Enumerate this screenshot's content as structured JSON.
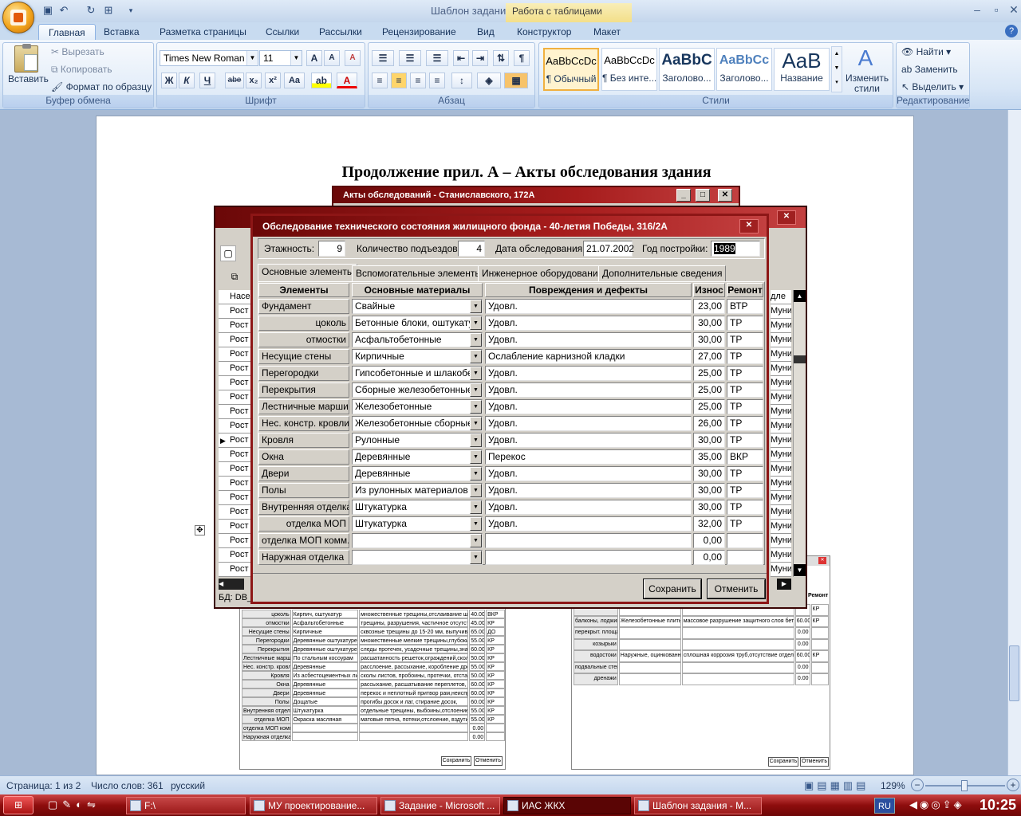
{
  "window": {
    "title": "Шаблон задания - Microsoft Word",
    "context_tab": "Работа с таблицами"
  },
  "tabs": [
    "Главная",
    "Вставка",
    "Разметка страницы",
    "Ссылки",
    "Рассылки",
    "Рецензирование",
    "Вид",
    "Конструктор",
    "Макет"
  ],
  "ribbon": {
    "clipboard": {
      "paste": "Вставить",
      "cut": "Вырезать",
      "copy": "Копировать",
      "format_painter": "Формат по образцу",
      "label": "Буфер обмена"
    },
    "font": {
      "name": "Times New Roman",
      "size": "11",
      "label": "Шрифт",
      "bold": "Ж",
      "italic": "К",
      "underline": "Ч",
      "strike": "abe",
      "sub": "x₂",
      "sup": "x²",
      "case": "Aa"
    },
    "paragraph": {
      "label": "Абзац"
    },
    "styles": {
      "label": "Стили",
      "items": [
        {
          "sample": "AaBbCcDc",
          "name": "¶ Обычный"
        },
        {
          "sample": "AaBbCcDc",
          "name": "¶ Без инте..."
        },
        {
          "sample": "AaBbC",
          "name": "Заголово..."
        },
        {
          "sample": "AaBbCc",
          "name": "Заголово..."
        },
        {
          "sample": "AaB",
          "name": "Название"
        }
      ],
      "change": "Изменить стили"
    },
    "editing": {
      "label": "Редактирование",
      "find": "Найти",
      "replace": "Заменить",
      "select": "Выделить"
    }
  },
  "document": {
    "heading": "Продолжение прил. А – Акты обследования здания"
  },
  "back_window": {
    "title": "Акты обследований - Станиславского, 172А",
    "status": "БД: DB_",
    "col_label": "Рост",
    "col_right": "Муни",
    "col_head_left": "Насе",
    "col_head_right": "дле"
  },
  "dialog": {
    "title": "Обследование технического состояния жилищного фонда - 40-летия Победы, 316/2А",
    "floors_label": "Этажность:",
    "floors": "9",
    "entrances_label": "Количество подъездов:",
    "entrances": "4",
    "date_label": "Дата обследования:",
    "date": "21.07.2002",
    "year_label": "Год постройки:",
    "year": "1989",
    "tabs": [
      "Основные элементы",
      "Вспомогательные элементы",
      "Инженерное оборудование",
      "Дополнительные сведения"
    ],
    "columns": [
      "Элементы",
      "Основные материалы",
      "Повреждения и дефекты",
      "Износ",
      "Ремонт"
    ],
    "rows": [
      {
        "el": "Фундамент",
        "mat": "Свайные",
        "def": "Удовл.",
        "wear": "23,00",
        "rep": "ВТР",
        "indent": false
      },
      {
        "el": "цоколь",
        "mat": "Бетонные блоки, оштукатур",
        "def": "Удовл.",
        "wear": "30,00",
        "rep": "ТР",
        "indent": true
      },
      {
        "el": "отмостки",
        "mat": "Асфальтобетонные",
        "def": "Удовл.",
        "wear": "30,00",
        "rep": "ТР",
        "indent": true
      },
      {
        "el": "Несущие стены",
        "mat": "Кирпичные",
        "def": "Ослабление карнизной кладки",
        "wear": "27,00",
        "rep": "ТР",
        "indent": false
      },
      {
        "el": "Перегородки",
        "mat": "Гипсобетонные и шлакобето",
        "def": "Удовл.",
        "wear": "25,00",
        "rep": "ТР",
        "indent": false
      },
      {
        "el": "Перекрытия",
        "mat": "Сборные железобетонные п",
        "def": "Удовл.",
        "wear": "25,00",
        "rep": "ТР",
        "indent": false
      },
      {
        "el": "Лестничные марши",
        "mat": "Железобетонные",
        "def": "Удовл.",
        "wear": "25,00",
        "rep": "ТР",
        "indent": false
      },
      {
        "el": "Нес. констр. кровли",
        "mat": "Железобетонные сборные",
        "def": "Удовл.",
        "wear": "26,00",
        "rep": "ТР",
        "indent": false
      },
      {
        "el": "Кровля",
        "mat": "Рулонные",
        "def": "Удовл.",
        "wear": "30,00",
        "rep": "ТР",
        "indent": false
      },
      {
        "el": "Окна",
        "mat": "Деревянные",
        "def": "Перекос",
        "wear": "35,00",
        "rep": "ВКР",
        "indent": false
      },
      {
        "el": "Двери",
        "mat": "Деревянные",
        "def": "Удовл.",
        "wear": "30,00",
        "rep": "ТР",
        "indent": false
      },
      {
        "el": "Полы",
        "mat": "Из рулонных материалов",
        "def": "Удовл.",
        "wear": "30,00",
        "rep": "ТР",
        "indent": false
      },
      {
        "el": "Внутренняя отделка",
        "mat": "Штукатурка",
        "def": "Удовл.",
        "wear": "30,00",
        "rep": "ТР",
        "indent": false
      },
      {
        "el": "отделка МОП",
        "mat": "Штукатурка",
        "def": "Удовл.",
        "wear": "32,00",
        "rep": "ТР",
        "indent": true
      },
      {
        "el": "отделка МОП комм.",
        "mat": "",
        "def": "",
        "wear": "0,00",
        "rep": "",
        "indent": true
      },
      {
        "el": "Наружная отделка",
        "mat": "",
        "def": "",
        "wear": "0,00",
        "rep": "",
        "indent": false
      }
    ],
    "save": "Сохранить",
    "cancel": "Отменить"
  },
  "mini_left": {
    "rows": [
      {
        "el": "цоколь",
        "mat": "Кирпич, оштукатур",
        "def": "множественные трещины,отслаивание штукатур",
        "wear": "40.00",
        "rep": "ВКР"
      },
      {
        "el": "отмостки",
        "mat": "Асфальтобетонные",
        "def": "трещины, разрушения, частичное отсутствие,",
        "wear": "45.00",
        "rep": "КР"
      },
      {
        "el": "Несущие стены",
        "mat": "Кирпичные",
        "def": "сквозные трещины до 15-20 мм, выпучивание",
        "wear": "65.00",
        "rep": "ДО"
      },
      {
        "el": "Перегородки",
        "mat": "Деревянные оштукатурен",
        "def": "множественные мелкие трещины,глубокие трещ",
        "wear": "55.00",
        "rep": "КР"
      },
      {
        "el": "Перекрытия",
        "mat": "Деревянные оштукатуре",
        "def": "следы протечек, усадочные трещины,значитель",
        "wear": "60.00",
        "rep": "КР"
      },
      {
        "el": "Лестничные марши",
        "mat": "По стальным косоурам",
        "def": "расшатанность решеток,ограждений,сколы, выбо",
        "wear": "50.00",
        "rep": "КР"
      },
      {
        "el": "Нес. констр. кровли",
        "mat": "Деревянные",
        "def": "расслоение, рассыхание, коробление древесины",
        "wear": "55.00",
        "rep": "КР"
      },
      {
        "el": "Кровля",
        "mat": "Из асбестоцементных лист",
        "def": "сколы листов, пробоины, протечки, отставания и",
        "wear": "50.00",
        "rep": "КР"
      },
      {
        "el": "Окна",
        "mat": "Деревянные",
        "def": "рассыхание, расшатывание переплетов, расслое",
        "wear": "60.00",
        "rep": "КР"
      },
      {
        "el": "Двери",
        "mat": "Деревянные",
        "def": "перекос и неплотный притвор рам,неисправност",
        "wear": "60.00",
        "rep": "КР"
      },
      {
        "el": "Полы",
        "mat": "Дощатые",
        "def": "прогибы досок и лаг, стирание досок,",
        "wear": "60.00",
        "rep": "КР"
      },
      {
        "el": "Внутренняя отделка",
        "mat": "Штукатурка",
        "def": "отдельные трещины, выбоины,отслоение и обру",
        "wear": "55.00",
        "rep": "КР"
      },
      {
        "el": "отделка МОП",
        "mat": "Окраска масляная",
        "def": "матовые пятна, потеки,отслоение, вздутие и нес",
        "wear": "55.00",
        "rep": "КР"
      },
      {
        "el": "отделка МОП комм.",
        "mat": "",
        "def": "",
        "wear": "0.00",
        "rep": ""
      },
      {
        "el": "Наружная отделка",
        "mat": "",
        "def": "",
        "wear": "0.00",
        "rep": ""
      }
    ],
    "save": "Сохранить",
    "cancel": "Отменить"
  },
  "mini_right": {
    "header_rep": "Ремонт",
    "rows": [
      {
        "el": "",
        "mat": "",
        "def": "",
        "wear": "",
        "rep": "КР"
      },
      {
        "el": "балконы, лоджии",
        "mat": "Железобетонные плиты по",
        "def": "массовое разрушение защитного слоя бетона,оп",
        "wear": "60.00",
        "rep": "КР"
      },
      {
        "el": "перекрыт. площадки",
        "mat": "",
        "def": "",
        "wear": "0.00",
        "rep": ""
      },
      {
        "el": "козырьки",
        "mat": "",
        "def": "",
        "wear": "0.00",
        "rep": ""
      },
      {
        "el": "водостоки",
        "mat": "Наружные, оцинкованные т",
        "def": "сплошная коррозия труб,отсутствие отдельн труб",
        "wear": "60.00",
        "rep": "КР"
      },
      {
        "el": "подвальные стенки",
        "mat": "",
        "def": "",
        "wear": "0.00",
        "rep": ""
      },
      {
        "el": "дренажи",
        "mat": "",
        "def": "",
        "wear": "0.00",
        "rep": ""
      }
    ],
    "save": "Сохранить",
    "cancel": "Отменить"
  },
  "statusbar": {
    "page": "Страница: 1 из 2",
    "words": "Число слов: 361",
    "lang": "русский",
    "zoom": "129%"
  },
  "taskbar": {
    "items": [
      "F:\\",
      "МУ проектирование...",
      "Задание - Microsoft ...",
      "ИАС ЖКХ",
      "Шаблон задания - M..."
    ],
    "lang": "RU",
    "time": "10:25"
  }
}
